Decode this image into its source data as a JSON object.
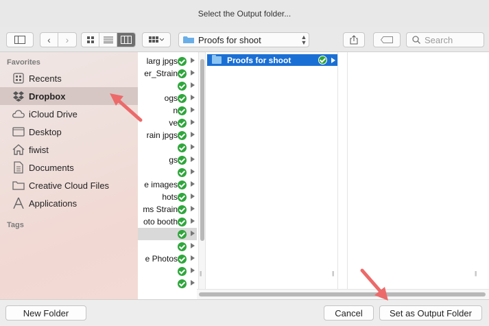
{
  "window": {
    "title": "Select the Output folder..."
  },
  "toolbar": {
    "location": "Proofs for shoot",
    "search_placeholder": "Search"
  },
  "sidebar": {
    "favorites_header": "Favorites",
    "tags_header": "Tags",
    "items": [
      {
        "label": "Recents",
        "icon": "recents-icon"
      },
      {
        "label": "Dropbox",
        "icon": "dropbox-icon",
        "selected": true
      },
      {
        "label": "iCloud Drive",
        "icon": "cloud-icon"
      },
      {
        "label": "Desktop",
        "icon": "desktop-icon"
      },
      {
        "label": "fiwist",
        "icon": "home-icon"
      },
      {
        "label": "Documents",
        "icon": "documents-icon"
      },
      {
        "label": "Creative Cloud Files",
        "icon": "folder-icon"
      },
      {
        "label": "Applications",
        "icon": "applications-icon"
      }
    ]
  },
  "browser": {
    "column1": [
      "larg jpgs",
      "er_Strain",
      "",
      "ogs",
      "n",
      "ve",
      "rain jpgs",
      "",
      "gs",
      "",
      "e images",
      "hots",
      "ms Strain",
      "oto booth",
      "",
      "",
      "e Photos",
      "",
      ""
    ],
    "selected_folder": "Proofs for shoot"
  },
  "buttons": {
    "new_folder": "New Folder",
    "cancel": "Cancel",
    "set_output": "Set as Output Folder"
  }
}
